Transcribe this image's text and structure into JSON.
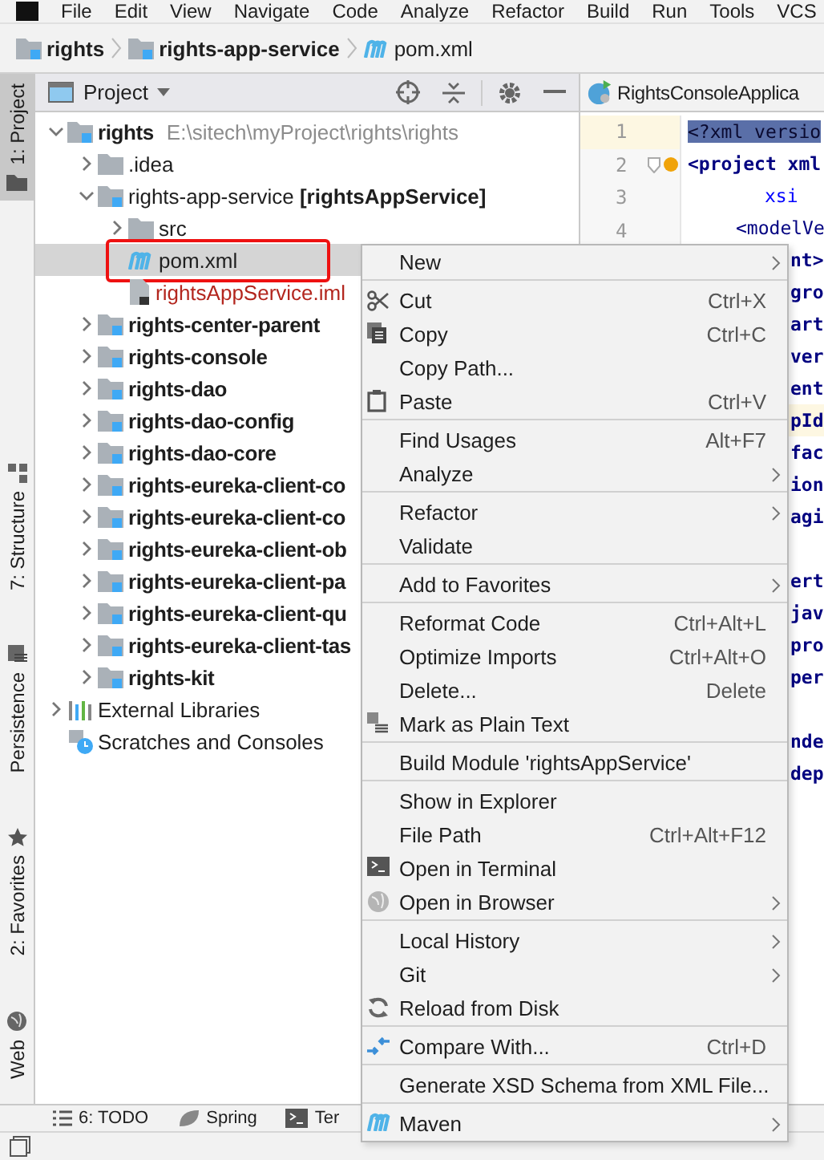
{
  "menubar": [
    "File",
    "Edit",
    "View",
    "Navigate",
    "Code",
    "Analyze",
    "Refactor",
    "Build",
    "Run",
    "Tools",
    "VCS"
  ],
  "breadcrumbs": [
    {
      "label": "rights",
      "kind": "module"
    },
    {
      "label": "rights-app-service",
      "kind": "module"
    },
    {
      "label": "pom.xml",
      "kind": "maven-file"
    }
  ],
  "side_tabs": [
    {
      "label": "1: Project",
      "selected": true,
      "kind": "project"
    },
    {
      "label": "7: Structure",
      "selected": false,
      "kind": "structure"
    },
    {
      "label": "Persistence",
      "selected": false,
      "kind": "persistence"
    },
    {
      "label": "2: Favorites",
      "selected": false,
      "kind": "favorites"
    },
    {
      "label": "Web",
      "selected": false,
      "kind": "web"
    }
  ],
  "project_panel": {
    "title": "Project",
    "tree": [
      {
        "label": "rights",
        "path": "E:\\sitech\\myProject\\rights\\rights",
        "kind": "module",
        "expanded": true,
        "selected": false,
        "children": [
          {
            "label": ".idea",
            "kind": "folder",
            "expanded": false,
            "selected": false
          },
          {
            "label": "rights-app-service **[rightsAppService]**",
            "kind": "module-renamed",
            "expanded": true,
            "selected": false,
            "children": [
              {
                "label": "src",
                "kind": "folder",
                "expanded": false,
                "selected": false
              },
              {
                "label": "pom.xml",
                "kind": "maven-file",
                "selected": true,
                "outlined": true
              },
              {
                "label": "rightsAppService.iml",
                "kind": "untracked-file",
                "selected": false
              }
            ]
          },
          {
            "label": "rights-center-parent",
            "kind": "module",
            "expanded": false,
            "selected": false
          },
          {
            "label": "rights-console",
            "kind": "module",
            "expanded": false,
            "selected": false
          },
          {
            "label": "rights-dao",
            "kind": "module",
            "expanded": false,
            "selected": false
          },
          {
            "label": "rights-dao-config",
            "kind": "module",
            "expanded": false,
            "selected": false
          },
          {
            "label": "rights-dao-core",
            "kind": "module",
            "expanded": false,
            "selected": false
          },
          {
            "label": "rights-eureka-client-co",
            "kind": "module",
            "expanded": false,
            "selected": false
          },
          {
            "label": "rights-eureka-client-co",
            "kind": "module",
            "expanded": false,
            "selected": false
          },
          {
            "label": "rights-eureka-client-ob",
            "kind": "module",
            "expanded": false,
            "selected": false
          },
          {
            "label": "rights-eureka-client-pa",
            "kind": "module",
            "expanded": false,
            "selected": false
          },
          {
            "label": "rights-eureka-client-qu",
            "kind": "module",
            "expanded": false,
            "selected": false
          },
          {
            "label": "rights-eureka-client-tas",
            "kind": "module",
            "expanded": false,
            "selected": false
          },
          {
            "label": "rights-kit",
            "kind": "module",
            "expanded": false,
            "selected": false
          }
        ]
      },
      {
        "label": "External Libraries",
        "kind": "libraries",
        "expanded": false,
        "selected": false
      },
      {
        "label": "Scratches and Consoles",
        "kind": "scratches",
        "selected": false
      }
    ]
  },
  "editor": {
    "tab": "RightsConsoleApplica",
    "line_numbers": [
      "1",
      "2",
      "3",
      "4"
    ],
    "lines": [
      {
        "kind": "prolog",
        "text": "<?xml versio",
        "selected": true
      },
      {
        "kind": "root",
        "text": "<project xml",
        "selected": false
      },
      {
        "kind": "attribute",
        "text": "xsi",
        "selected": false
      },
      {
        "kind": "child",
        "text": "<modelVe",
        "selected": false
      },
      {
        "kind": "fragment",
        "text": "nt>",
        "selected": false
      },
      {
        "kind": "fragment",
        "text": "gro",
        "selected": false
      },
      {
        "kind": "fragment",
        "text": "art",
        "selected": false
      },
      {
        "kind": "fragment",
        "text": "ver",
        "selected": false
      },
      {
        "kind": "fragment",
        "text": "ent",
        "selected": false
      },
      {
        "kind": "fragment",
        "text": "pId",
        "selected": false,
        "highlighted": true
      },
      {
        "kind": "fragment",
        "text": "fac",
        "selected": false
      },
      {
        "kind": "fragment",
        "text": "ion",
        "selected": false
      },
      {
        "kind": "fragment",
        "text": "agi",
        "selected": false
      },
      {
        "kind": "blank"
      },
      {
        "kind": "fragment",
        "text": "ert",
        "selected": false
      },
      {
        "kind": "fragment",
        "text": "jav",
        "selected": false
      },
      {
        "kind": "fragment",
        "text": "pro",
        "selected": false
      },
      {
        "kind": "fragment",
        "text": "per",
        "selected": false
      },
      {
        "kind": "blank"
      },
      {
        "kind": "fragment",
        "text": "nde",
        "selected": false
      },
      {
        "kind": "fragment",
        "text": "dep",
        "selected": false
      }
    ]
  },
  "context_menu": [
    {
      "kind": "plain",
      "label": "New",
      "submenu": true
    },
    {
      "kind": "separator"
    },
    {
      "kind": "cut",
      "label": "Cut",
      "shortcut": "Ctrl+X"
    },
    {
      "kind": "copy",
      "label": "Copy",
      "shortcut": "Ctrl+C"
    },
    {
      "kind": "plain",
      "label": "Copy Path..."
    },
    {
      "kind": "paste",
      "label": "Paste",
      "shortcut": "Ctrl+V"
    },
    {
      "kind": "separator"
    },
    {
      "kind": "plain",
      "label": "Find Usages",
      "shortcut": "Alt+F7"
    },
    {
      "kind": "plain",
      "label": "Analyze",
      "submenu": true
    },
    {
      "kind": "separator"
    },
    {
      "kind": "plain",
      "label": "Refactor",
      "submenu": true
    },
    {
      "kind": "plain",
      "label": "Validate"
    },
    {
      "kind": "separator"
    },
    {
      "kind": "plain",
      "label": "Add to Favorites",
      "submenu": true
    },
    {
      "kind": "separator"
    },
    {
      "kind": "plain",
      "label": "Reformat Code",
      "shortcut": "Ctrl+Alt+L"
    },
    {
      "kind": "plain",
      "label": "Optimize Imports",
      "shortcut": "Ctrl+Alt+O"
    },
    {
      "kind": "plain",
      "label": "Delete...",
      "shortcut": "Delete"
    },
    {
      "kind": "plaintext",
      "label": "Mark as Plain Text"
    },
    {
      "kind": "separator"
    },
    {
      "kind": "plain",
      "label": "Build Module 'rightsAppService'"
    },
    {
      "kind": "separator"
    },
    {
      "kind": "plain",
      "label": "Show in Explorer"
    },
    {
      "kind": "plain",
      "label": "File Path",
      "shortcut": "Ctrl+Alt+F12"
    },
    {
      "kind": "terminal",
      "label": "Open in Terminal"
    },
    {
      "kind": "browser",
      "label": "Open in Browser",
      "submenu": true
    },
    {
      "kind": "separator"
    },
    {
      "kind": "plain",
      "label": "Local History",
      "submenu": true
    },
    {
      "kind": "plain",
      "label": "Git",
      "submenu": true
    },
    {
      "kind": "reload",
      "label": "Reload from Disk"
    },
    {
      "kind": "separator"
    },
    {
      "kind": "compare",
      "label": "Compare With...",
      "shortcut": "Ctrl+D"
    },
    {
      "kind": "separator"
    },
    {
      "kind": "plain",
      "label": "Generate XSD Schema from XML File..."
    },
    {
      "kind": "separator"
    },
    {
      "kind": "maven",
      "label": "Maven",
      "submenu": true
    }
  ],
  "bottom_tabs": [
    {
      "label": "6: TODO",
      "kind": "todo"
    },
    {
      "label": "Spring",
      "kind": "spring"
    },
    {
      "label": "Ter",
      "kind": "terminal"
    }
  ]
}
